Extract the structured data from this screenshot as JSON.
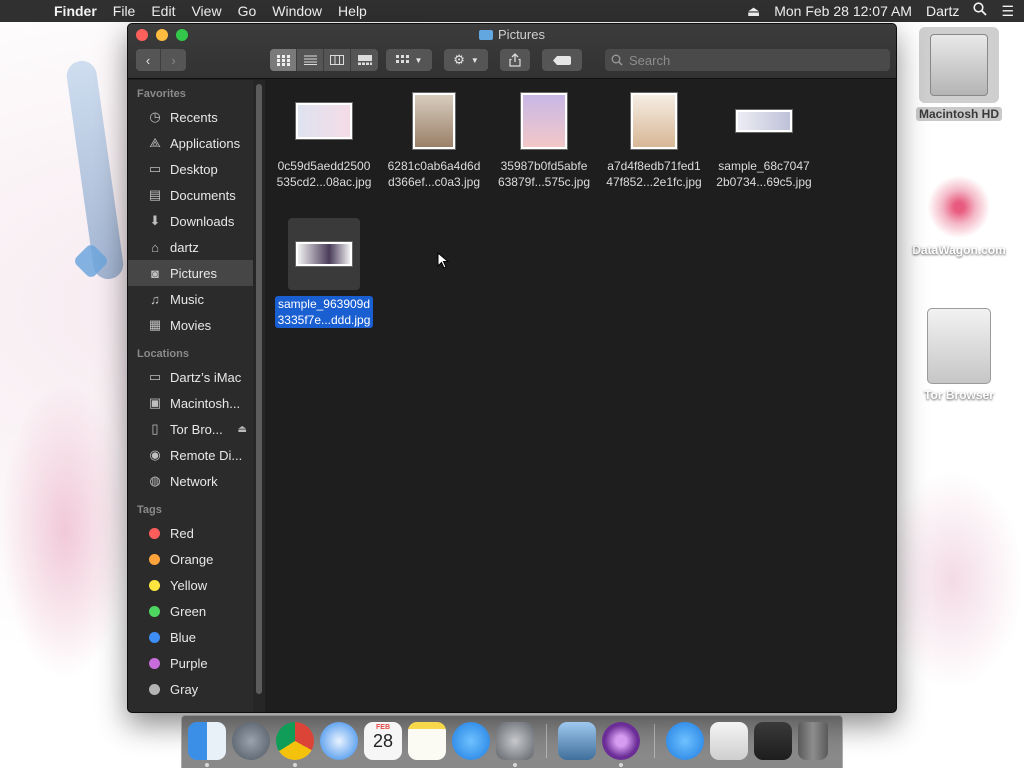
{
  "menubar": {
    "app_name": "Finder",
    "items": [
      "File",
      "Edit",
      "View",
      "Go",
      "Window",
      "Help"
    ],
    "clock": "Mon Feb 28  12:07 AM",
    "user": "Dartz"
  },
  "window": {
    "title": "Pictures",
    "search_placeholder": "Search"
  },
  "sidebar": {
    "favorites_header": "Favorites",
    "favorites": [
      {
        "label": "Recents",
        "icon": "clock-icon"
      },
      {
        "label": "Applications",
        "icon": "applications-icon"
      },
      {
        "label": "Desktop",
        "icon": "desktop-icon"
      },
      {
        "label": "Documents",
        "icon": "document-icon"
      },
      {
        "label": "Downloads",
        "icon": "download-icon"
      },
      {
        "label": "dartz",
        "icon": "home-icon"
      },
      {
        "label": "Pictures",
        "icon": "camera-icon"
      },
      {
        "label": "Music",
        "icon": "music-icon"
      },
      {
        "label": "Movies",
        "icon": "film-icon"
      }
    ],
    "locations_header": "Locations",
    "locations": [
      {
        "label": "Dartz’s iMac",
        "icon": "imac-icon"
      },
      {
        "label": "Macintosh...",
        "icon": "hard-drive-icon"
      },
      {
        "label": "Tor Bro...",
        "icon": "disk-image-icon"
      },
      {
        "label": "Remote Di...",
        "icon": "optical-disc-icon"
      },
      {
        "label": "Network",
        "icon": "globe-icon"
      }
    ],
    "tags_header": "Tags",
    "tags": [
      {
        "label": "Red",
        "color": "#fc5c5a"
      },
      {
        "label": "Orange",
        "color": "#fda33c"
      },
      {
        "label": "Yellow",
        "color": "#fde53f"
      },
      {
        "label": "Green",
        "color": "#4dd660"
      },
      {
        "label": "Blue",
        "color": "#3d8ef8"
      },
      {
        "label": "Purple",
        "color": "#c86cdc"
      },
      {
        "label": "Gray",
        "color": "#b4b4b4"
      }
    ]
  },
  "files": [
    {
      "line1": "0c59d5aedd2500",
      "line2": "535cd2...08ac.jpg"
    },
    {
      "line1": "6281c0ab6a4d6d",
      "line2": "d366ef...c0a3.jpg"
    },
    {
      "line1": "35987b0fd5abfe",
      "line2": "63879f...575c.jpg"
    },
    {
      "line1": "a7d4f8edb71fed1",
      "line2": "47f852...2e1fc.jpg"
    },
    {
      "line1": "sample_68c7047",
      "line2": "2b0734...69c5.jpg"
    },
    {
      "line1": "sample_963909d",
      "line2": "3335f7e...ddd.jpg"
    }
  ],
  "desktop": {
    "hd_label": "Macintosh HD",
    "site_label": "DataWagon.com",
    "tor_label": "Tor Browser"
  },
  "dock": {
    "apps": [
      "finder-icon",
      "launchpad-icon",
      "chrome-icon",
      "safari-icon",
      "calendar-icon",
      "notes-icon",
      "app-store-icon",
      "system-preferences-icon",
      "preview-icon",
      "tor-browser-icon",
      "applications-folder-icon",
      "downloads-stack-icon",
      "screenshot-icon",
      "trash-icon"
    ],
    "calendar_month": "FEB",
    "calendar_day": "28"
  }
}
